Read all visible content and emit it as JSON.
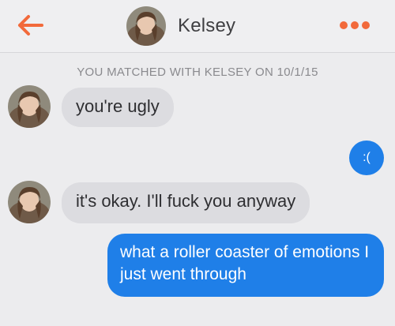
{
  "header": {
    "name": "Kelsey",
    "back_icon": "back-arrow-icon",
    "menu_icon": "more-dots-icon",
    "accent_color": "#f26a3b"
  },
  "match_banner": "YOU MATCHED WITH KELSEY ON 10/1/15",
  "messages": [
    {
      "from": "Kelsey",
      "text": "you're ugly"
    },
    {
      "from": "me",
      "text": ":("
    },
    {
      "from": "Kelsey",
      "text": "it's okay. I'll fuck you anyway"
    },
    {
      "from": "me",
      "text": "what a roller coaster of emotions I just went through"
    }
  ],
  "colors": {
    "incoming_bubble": "#dcdce0",
    "outgoing_bubble": "#1f7fe8",
    "background": "#ececee"
  }
}
